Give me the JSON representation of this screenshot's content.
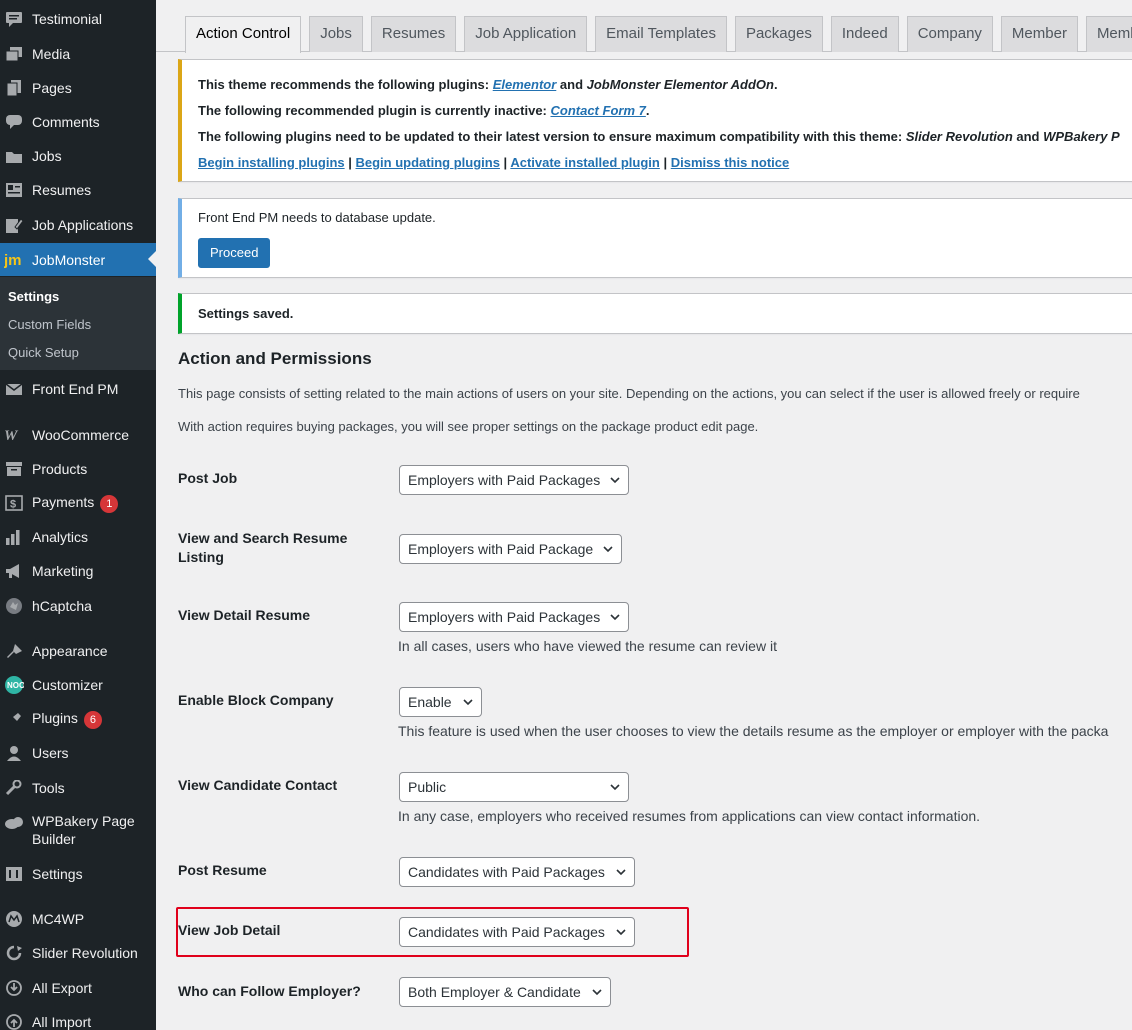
{
  "sidebar": {
    "items": [
      {
        "label": "Testimonial",
        "icon": "testimonial-icon"
      },
      {
        "label": "Media",
        "icon": "media-icon"
      },
      {
        "label": "Pages",
        "icon": "pages-icon"
      },
      {
        "label": "Comments",
        "icon": "comments-icon"
      },
      {
        "label": "Jobs",
        "icon": "jobs-icon"
      },
      {
        "label": "Resumes",
        "icon": "resumes-icon"
      },
      {
        "label": "Job Applications",
        "icon": "job-applications-icon"
      },
      {
        "label": "JobMonster",
        "icon": "jobmonster-logo-icon"
      },
      {
        "label": "Front End PM",
        "icon": "front-end-pm-icon"
      },
      {
        "label": "WooCommerce",
        "icon": "woocommerce-icon"
      },
      {
        "label": "Products",
        "icon": "products-icon"
      },
      {
        "label": "Payments",
        "icon": "payments-icon",
        "badge": "1"
      },
      {
        "label": "Analytics",
        "icon": "analytics-icon"
      },
      {
        "label": "Marketing",
        "icon": "marketing-icon"
      },
      {
        "label": "hCaptcha",
        "icon": "hcaptcha-icon"
      },
      {
        "label": "Appearance",
        "icon": "appearance-icon"
      },
      {
        "label": "Customizer",
        "icon": "customizer-icon"
      },
      {
        "label": "Plugins",
        "icon": "plugins-icon",
        "badge": "6"
      },
      {
        "label": "Users",
        "icon": "users-icon"
      },
      {
        "label": "Tools",
        "icon": "tools-icon"
      },
      {
        "label": "WPBakery Page Builder",
        "icon": "wpbakery-icon"
      },
      {
        "label": "Settings",
        "icon": "settings-icon"
      },
      {
        "label": "MC4WP",
        "icon": "mc4wp-icon"
      },
      {
        "label": "Slider Revolution",
        "icon": "slider-revolution-icon"
      },
      {
        "label": "All Export",
        "icon": "all-export-icon"
      },
      {
        "label": "All Import",
        "icon": "all-import-icon"
      }
    ],
    "submenu": [
      "Settings",
      "Custom Fields",
      "Quick Setup"
    ]
  },
  "tabs": [
    "Action Control",
    "Jobs",
    "Resumes",
    "Job Application",
    "Email Templates",
    "Packages",
    "Indeed",
    "Company",
    "Member",
    "Memb"
  ],
  "notices": {
    "plugins": {
      "line1_pre": "This theme recommends the following plugins: ",
      "line1_link": "Elementor",
      "line1_mid": " and ",
      "line1_em": "JobMonster Elementor AddOn",
      "line1_post": ".",
      "line2_pre": "The following recommended plugin is currently inactive: ",
      "line2_link": "Contact Form 7",
      "line2_post": ".",
      "line3_pre": "The following plugins need to be updated to their latest version to ensure maximum compatibility with this theme: ",
      "line3_em1": "Slider Revolution",
      "line3_mid": " and ",
      "line3_em2": "WPBakery P",
      "action_install": "Begin installing plugins",
      "action_update": "Begin updating plugins",
      "action_activate": "Activate installed plugin",
      "action_dismiss": "Dismiss this notice",
      "separator": " | "
    },
    "fepm": {
      "text": "Front End PM needs to database update.",
      "button": "Proceed"
    },
    "saved": {
      "text": "Settings saved."
    }
  },
  "section": {
    "title": "Action and Permissions",
    "desc1": "This page consists of setting related to the main actions of users on your site. Depending on the actions, you can select if the user is allowed freely or require",
    "desc2": "With action requires buying packages, you will see proper settings on the package product edit page."
  },
  "settings": [
    {
      "label": "Post Job",
      "value": "Employers with Paid Packages",
      "desc": ""
    },
    {
      "label": "View and Search Resume Listing",
      "value": "Employers with Paid Package",
      "desc": ""
    },
    {
      "label": "View Detail Resume",
      "value": "Employers with Paid Packages",
      "desc": "In all cases, users who have viewed the resume can review it"
    },
    {
      "label": "Enable Block Company",
      "value": "Enable",
      "desc": "This feature is used when the user chooses to view the details resume as the employer or employer with the packa"
    },
    {
      "label": "View Candidate Contact",
      "value": "Public",
      "desc": "In any case, employers who received resumes from applications can view contact information."
    },
    {
      "label": "Post Resume",
      "value": "Candidates with Paid Packages",
      "desc": ""
    },
    {
      "label": "View Job Detail",
      "value": "Candidates with Paid Packages",
      "desc": ""
    },
    {
      "label": "Who can Follow Employer?",
      "value": "Both Employer & Candidate",
      "desc": ""
    }
  ],
  "colors": {
    "sidebar_bg": "#1d2327",
    "accent": "#2271b1",
    "warning": "#dba617",
    "success": "#00a32a",
    "info": "#72aee6",
    "badge": "#d63638",
    "highlight": "#e0001b"
  }
}
